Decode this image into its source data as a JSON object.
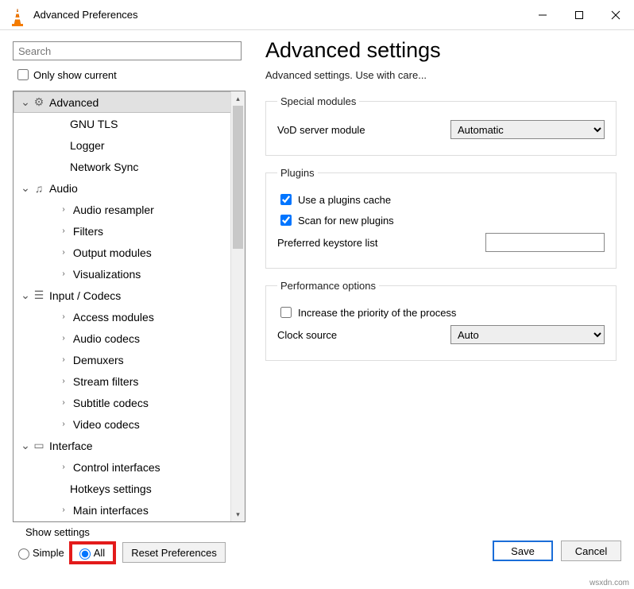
{
  "window": {
    "title": "Advanced Preferences"
  },
  "sidebar": {
    "search_placeholder": "Search",
    "only_show_current": "Only show current",
    "tree": {
      "advanced": {
        "label": "Advanced",
        "items": [
          "GNU TLS",
          "Logger",
          "Network Sync"
        ]
      },
      "audio": {
        "label": "Audio",
        "items": [
          "Audio resampler",
          "Filters",
          "Output modules",
          "Visualizations"
        ]
      },
      "input": {
        "label": "Input / Codecs",
        "items": [
          "Access modules",
          "Audio codecs",
          "Demuxers",
          "Stream filters",
          "Subtitle codecs",
          "Video codecs"
        ]
      },
      "interface": {
        "label": "Interface",
        "items": [
          "Control interfaces",
          "Hotkeys settings",
          "Main interfaces"
        ]
      }
    }
  },
  "main": {
    "heading": "Advanced settings",
    "subtitle": "Advanced settings. Use with care...",
    "special": {
      "legend": "Special modules",
      "vod_label": "VoD server module",
      "vod_value": "Automatic"
    },
    "plugins": {
      "legend": "Plugins",
      "use_cache": "Use a plugins cache",
      "scan_new": "Scan for new plugins",
      "keystore_label": "Preferred keystore list",
      "keystore_value": ""
    },
    "perf": {
      "legend": "Performance options",
      "increase_priority": "Increase the priority of the process",
      "clock_label": "Clock source",
      "clock_value": "Auto"
    }
  },
  "footer": {
    "show_settings": "Show settings",
    "simple": "Simple",
    "all": "All",
    "reset": "Reset Preferences",
    "save": "Save",
    "cancel": "Cancel"
  },
  "watermark": "wsxdn.com"
}
